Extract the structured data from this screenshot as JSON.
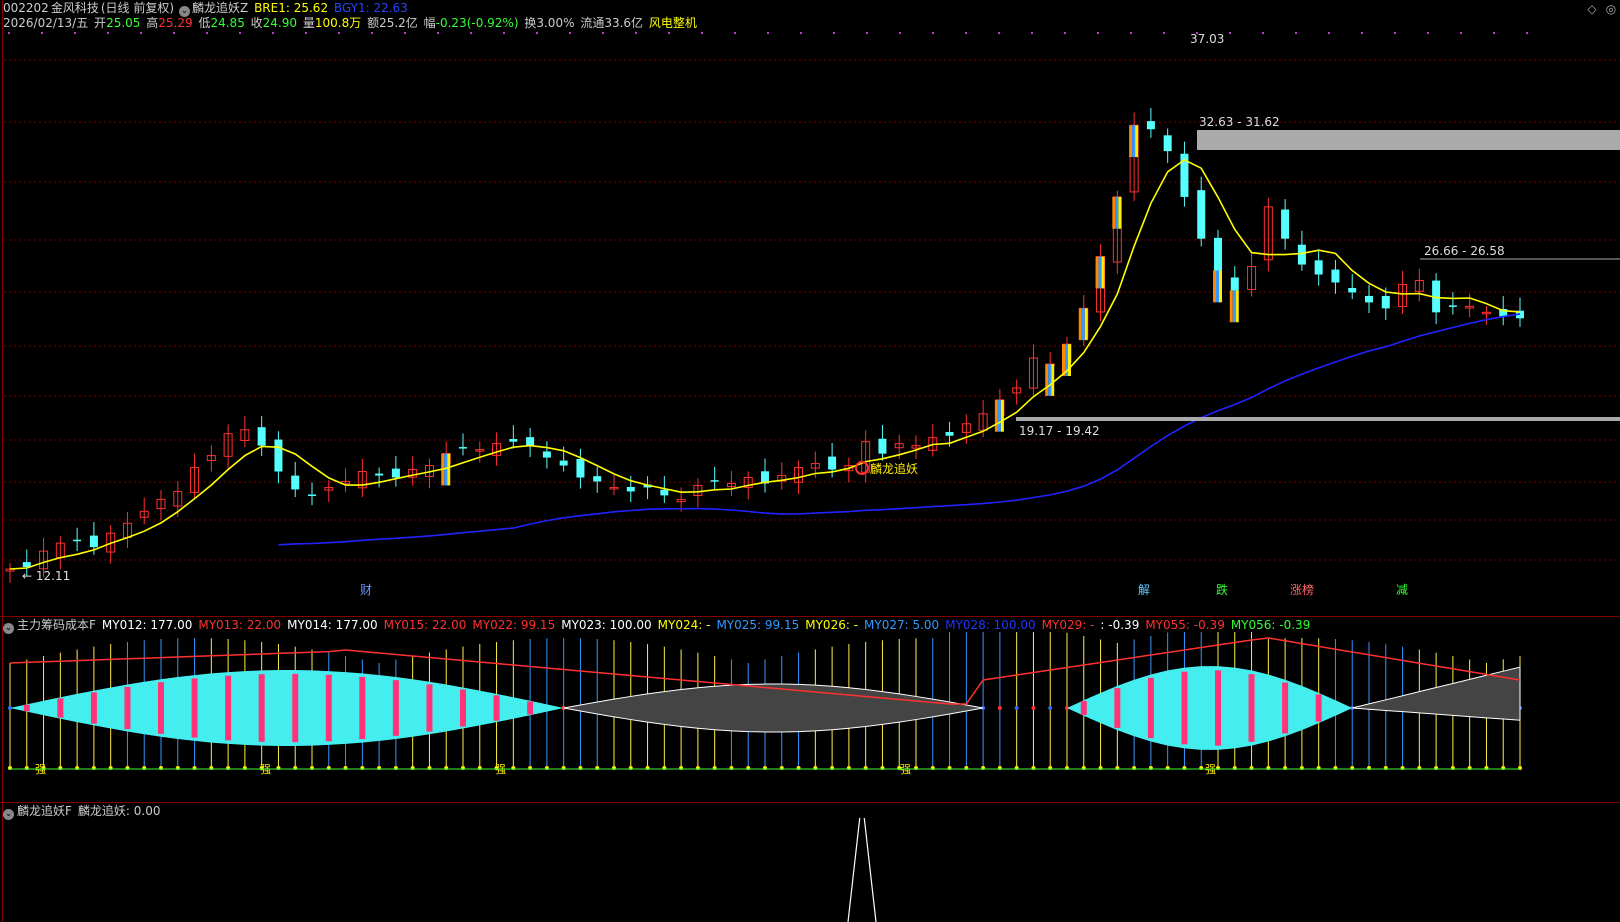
{
  "header": {
    "code": "002202",
    "name": "金风科技",
    "period": "(日线 前复权)",
    "indicator_name": "麟龙追妖Z",
    "bre_label": "BRE1: 25.62",
    "bgy_label": "BGY1: 22.63",
    "date": "2026/02/13/五",
    "open_label": "开",
    "open": "25.05",
    "high_label": "高",
    "high": "25.29",
    "low_label": "低",
    "low": "24.85",
    "close_label": "收",
    "close": "24.90",
    "vol_label": "量",
    "vol": "100.8万",
    "amt_label": "额",
    "amt": "25.2亿",
    "chg_label": "幅",
    "chg": "-0.23(-0.92%)",
    "turn": "换3.00%",
    "float": "流通33.6亿",
    "concept": "风电整机"
  },
  "main_chart": {
    "annotations": {
      "peak": "37.03",
      "low_mark": "12.11",
      "zone_top": "32.63 - 31.62",
      "zone_mid": "26.66 - 26.58",
      "zone_low": "19.17 - 19.42",
      "signal": "麟龙追妖"
    },
    "event_tags": [
      "财",
      "解",
      "跌",
      "涨榜",
      "减"
    ]
  },
  "panel2": {
    "title": "主力筹码成本F",
    "items": [
      {
        "text": "MY012: 177.00",
        "color": "#ffffff"
      },
      {
        "text": "MY013: 22.00",
        "color": "#ff3030"
      },
      {
        "text": "MY014: 177.00",
        "color": "#ffffff"
      },
      {
        "text": "MY015: 22.00",
        "color": "#ff3030"
      },
      {
        "text": "MY022: 99.15",
        "color": "#ff3030"
      },
      {
        "text": "MY023: 100.00",
        "color": "#ffffff"
      },
      {
        "text": "MY024: -",
        "color": "#ffff00"
      },
      {
        "text": "MY025: 99.15",
        "color": "#3399ff"
      },
      {
        "text": "MY026: -",
        "color": "#ffff00"
      },
      {
        "text": "MY027: 5.00",
        "color": "#3399ff"
      },
      {
        "text": "MY028: 100.00",
        "color": "#2233ff"
      },
      {
        "text": "MY029: -",
        "color": "#ff3030"
      },
      {
        "text": ": -0.39",
        "color": "#ffffff"
      },
      {
        "text": "MY055: -0.39",
        "color": "#ff3030"
      },
      {
        "text": "MY056: -0.39",
        "color": "#33ff33"
      }
    ],
    "strong_label": "强"
  },
  "panel3": {
    "title": "麟龙追妖F",
    "value_label": "麟龙追妖: 0.00"
  },
  "colors": {
    "up": "#ff3030",
    "down": "#55ffff",
    "ma_short": "#ffff00",
    "ma_long": "#2222ff",
    "grid": "#800000"
  }
}
